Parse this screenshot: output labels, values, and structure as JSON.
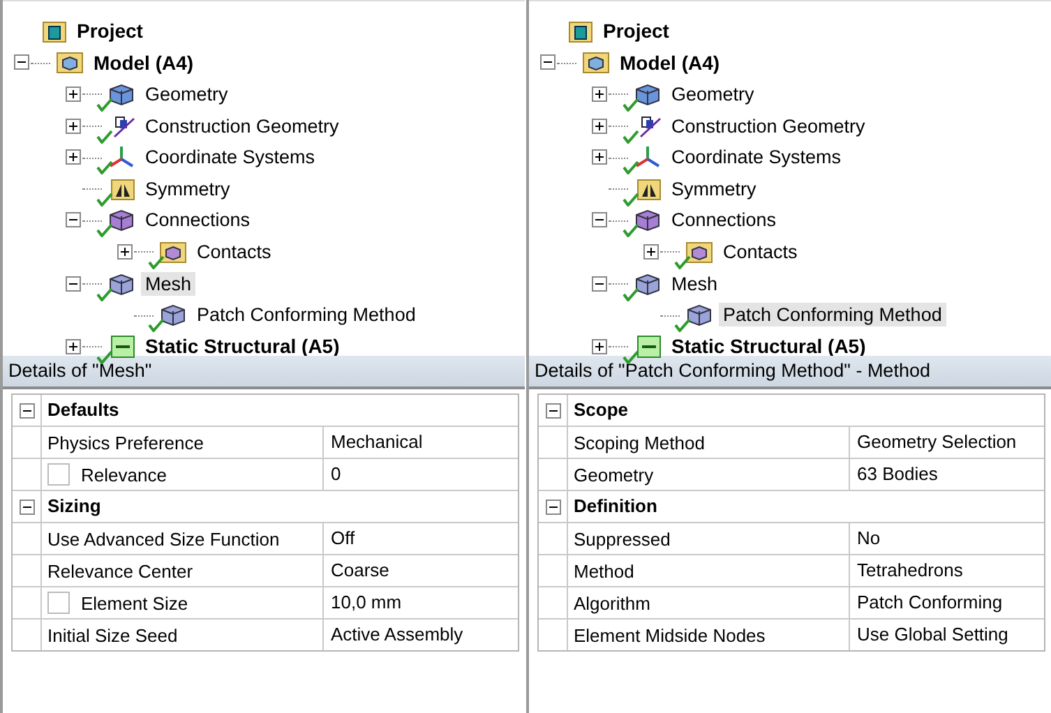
{
  "panels": [
    {
      "tree": {
        "label": "Project",
        "kind": "project",
        "bold": true,
        "checked": false,
        "selected": false,
        "children": [
          {
            "label": "Model (A4)",
            "kind": "model",
            "bold": true,
            "checked": false,
            "selected": false,
            "expanded": true,
            "children": [
              {
                "label": "Geometry",
                "kind": "geometry",
                "bold": false,
                "checked": true,
                "selected": false,
                "expanded": false
              },
              {
                "label": "Construction Geometry",
                "kind": "construction",
                "bold": false,
                "checked": true,
                "selected": false,
                "expanded": false
              },
              {
                "label": "Coordinate Systems",
                "kind": "axes",
                "bold": false,
                "checked": true,
                "selected": false,
                "expanded": false
              },
              {
                "label": "Symmetry",
                "kind": "symmetry",
                "bold": false,
                "checked": true,
                "selected": false
              },
              {
                "label": "Connections",
                "kind": "connections",
                "bold": false,
                "checked": true,
                "selected": false,
                "expanded": true,
                "children": [
                  {
                    "label": "Contacts",
                    "kind": "contacts",
                    "bold": false,
                    "checked": true,
                    "selected": false,
                    "expanded": false
                  }
                ]
              },
              {
                "label": "Mesh",
                "kind": "mesh",
                "bold": false,
                "checked": true,
                "selected": true,
                "expanded": true,
                "children": [
                  {
                    "label": "Patch Conforming Method",
                    "kind": "mesh",
                    "bold": false,
                    "checked": true,
                    "selected": false
                  }
                ]
              },
              {
                "label": "Static Structural (A5)",
                "kind": "static",
                "bold": true,
                "checked": true,
                "selected": false,
                "expanded": false
              }
            ]
          }
        ]
      },
      "details": {
        "title": "Details of \"Mesh\"",
        "sections": [
          {
            "name": "Defaults",
            "expanded": true,
            "rows": [
              {
                "kind": "plain",
                "property": "Physics Preference",
                "value": "Mechanical"
              },
              {
                "kind": "checkbox",
                "checked": false,
                "property": "Relevance",
                "value": "0"
              }
            ]
          },
          {
            "name": "Sizing",
            "expanded": true,
            "rows": [
              {
                "kind": "plain",
                "property": "Use Advanced Size Function",
                "value": "Off"
              },
              {
                "kind": "plain",
                "property": "Relevance Center",
                "value": "Coarse"
              },
              {
                "kind": "checkbox",
                "checked": false,
                "property": "Element Size",
                "value": "10,0 mm"
              },
              {
                "kind": "plain",
                "property": "Initial Size Seed",
                "value": "Active Assembly"
              }
            ]
          }
        ]
      }
    },
    {
      "tree": {
        "label": "Project",
        "kind": "project",
        "bold": true,
        "checked": false,
        "selected": false,
        "children": [
          {
            "label": "Model (A4)",
            "kind": "model",
            "bold": true,
            "checked": false,
            "selected": false,
            "expanded": true,
            "children": [
              {
                "label": "Geometry",
                "kind": "geometry",
                "bold": false,
                "checked": true,
                "selected": false,
                "expanded": false
              },
              {
                "label": "Construction Geometry",
                "kind": "construction",
                "bold": false,
                "checked": true,
                "selected": false,
                "expanded": false
              },
              {
                "label": "Coordinate Systems",
                "kind": "axes",
                "bold": false,
                "checked": true,
                "selected": false,
                "expanded": false
              },
              {
                "label": "Symmetry",
                "kind": "symmetry",
                "bold": false,
                "checked": true,
                "selected": false
              },
              {
                "label": "Connections",
                "kind": "connections",
                "bold": false,
                "checked": true,
                "selected": false,
                "expanded": true,
                "children": [
                  {
                    "label": "Contacts",
                    "kind": "contacts",
                    "bold": false,
                    "checked": true,
                    "selected": false,
                    "expanded": false
                  }
                ]
              },
              {
                "label": "Mesh",
                "kind": "mesh",
                "bold": false,
                "checked": true,
                "selected": false,
                "expanded": true,
                "children": [
                  {
                    "label": "Patch Conforming Method",
                    "kind": "mesh",
                    "bold": false,
                    "checked": true,
                    "selected": true
                  }
                ]
              },
              {
                "label": "Static Structural (A5)",
                "kind": "static",
                "bold": true,
                "checked": true,
                "selected": false,
                "expanded": false
              }
            ]
          }
        ]
      },
      "details": {
        "title": "Details of \"Patch Conforming Method\" - Method",
        "sections": [
          {
            "name": "Scope",
            "expanded": true,
            "rows": [
              {
                "kind": "plain",
                "property": "Scoping Method",
                "value": "Geometry Selection"
              },
              {
                "kind": "plain",
                "property": "Geometry",
                "value": "63 Bodies"
              }
            ]
          },
          {
            "name": "Definition",
            "expanded": true,
            "rows": [
              {
                "kind": "plain",
                "property": "Suppressed",
                "value": "No"
              },
              {
                "kind": "plain",
                "property": "Method",
                "value": "Tetrahedrons"
              },
              {
                "kind": "plain",
                "property": "Algorithm",
                "value": "Patch Conforming"
              },
              {
                "kind": "plain",
                "property": "Element Midside Nodes",
                "value": "Use Global Setting"
              }
            ]
          }
        ]
      }
    }
  ]
}
